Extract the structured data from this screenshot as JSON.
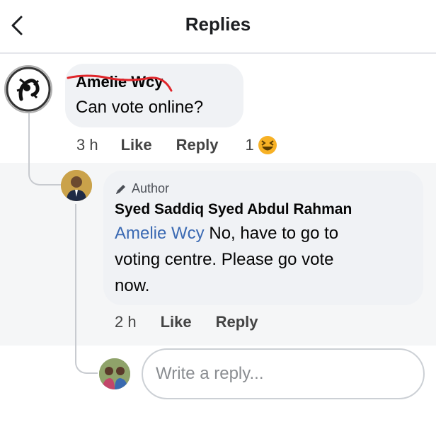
{
  "header": {
    "title": "Replies",
    "back_icon": "chevron-left-icon"
  },
  "comment": {
    "author": "Amelie Wcy",
    "author_strikethrough_color": "#e0262b",
    "text": "Can vote online?",
    "time": "3 h",
    "like_label": "Like",
    "reply_label": "Reply",
    "reaction_count": "1",
    "reaction_icon": "laughing-emoji-icon"
  },
  "reply": {
    "badge_label": "Author",
    "badge_icon": "pencil-icon",
    "author": "Syed Saddiq Syed Abdul Rahman",
    "mention": "Amelie Wcy",
    "text_lines": [
      " No, have to go to",
      "voting centre. Please go vote",
      "now."
    ],
    "time": "2 h",
    "like_label": "Like",
    "reply_label": "Reply"
  },
  "composer": {
    "placeholder": "Write a reply..."
  },
  "colors": {
    "mention": "#3b6ab3",
    "bubble": "#f0f2f5",
    "reaction": "#f7b125"
  }
}
